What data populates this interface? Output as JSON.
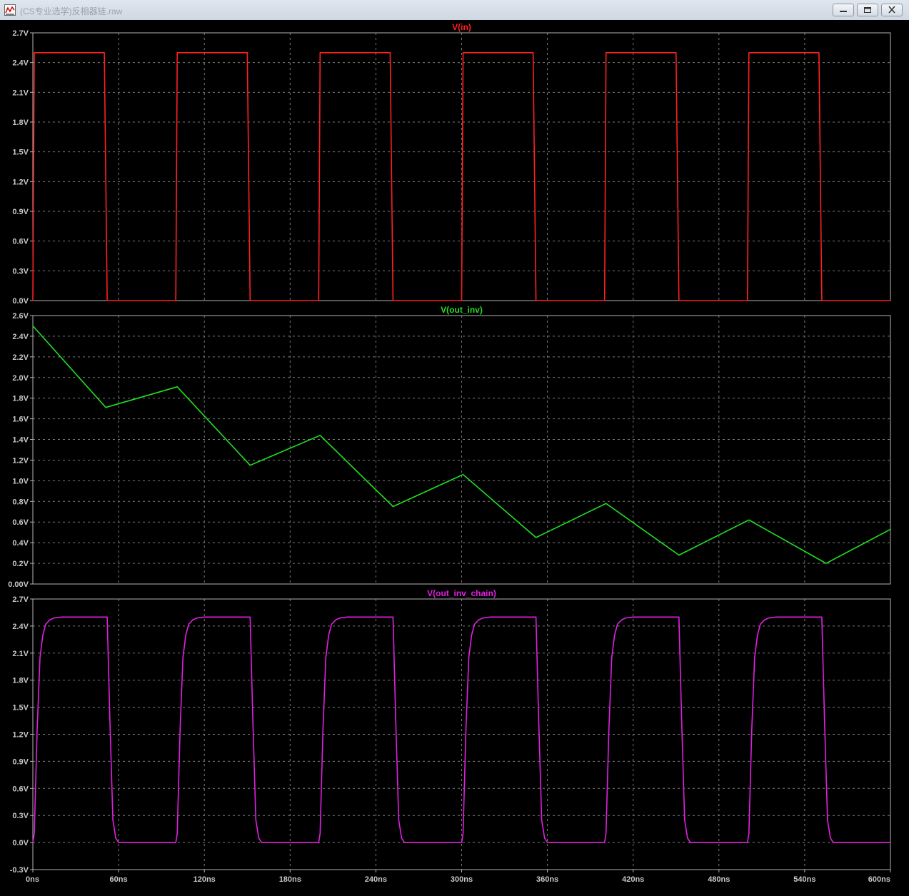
{
  "window": {
    "title": "(CS专业选学)反相器链.raw",
    "icon": "waveform-icon",
    "controls": [
      "minimize-icon",
      "maximize-icon",
      "close-icon"
    ]
  },
  "colors": {
    "background": "#000000",
    "grid": "#7a7a7a",
    "border": "#b4b4b4",
    "labels": "#c8c8c8"
  },
  "x_axis": {
    "unit": "ns",
    "range": [
      0,
      600
    ],
    "ticks": [
      0,
      60,
      120,
      180,
      240,
      300,
      360,
      420,
      480,
      540,
      600
    ],
    "tick_labels": [
      "0ns",
      "60ns",
      "120ns",
      "180ns",
      "240ns",
      "300ns",
      "360ns",
      "420ns",
      "480ns",
      "540ns",
      "600ns"
    ]
  },
  "chart_data": [
    {
      "type": "line",
      "title": "V(in)",
      "color": "#ff2020",
      "x_unit": "ns",
      "y_unit": "V",
      "ylim": [
        0,
        2.7
      ],
      "y_ticks": [
        0,
        0.3,
        0.6,
        0.9,
        1.2,
        1.5,
        1.8,
        2.1,
        2.4,
        2.7
      ],
      "y_tick_labels": [
        "0.0V",
        "0.3V",
        "0.6V",
        "0.9V",
        "1.2V",
        "1.5V",
        "1.8V",
        "2.1V",
        "2.4V",
        "2.7V"
      ],
      "grid": true,
      "x": [
        0,
        1,
        50,
        52,
        100,
        101,
        150,
        152,
        200,
        201,
        250,
        252,
        300,
        301,
        350,
        352,
        400,
        401,
        450,
        452,
        500,
        501,
        550,
        552,
        600
      ],
      "y": [
        0,
        2.5,
        2.5,
        0,
        0,
        2.5,
        2.5,
        0,
        0,
        2.5,
        2.5,
        0,
        0,
        2.5,
        2.5,
        0,
        0,
        2.5,
        2.5,
        0,
        0,
        2.5,
        2.5,
        0,
        0
      ]
    },
    {
      "type": "line",
      "title": "V(out_inv)",
      "color": "#22e022",
      "x_unit": "ns",
      "y_unit": "V",
      "ylim": [
        0,
        2.6
      ],
      "y_ticks": [
        0,
        0.2,
        0.4,
        0.6,
        0.8,
        1.0,
        1.2,
        1.4,
        1.6,
        1.8,
        2.0,
        2.2,
        2.4,
        2.6
      ],
      "y_tick_labels": [
        "0.00V",
        "0.2V",
        "0.4V",
        "0.6V",
        "0.8V",
        "1.0V",
        "1.2V",
        "1.4V",
        "1.6V",
        "1.8V",
        "2.0V",
        "2.2V",
        "2.4V",
        "2.6V"
      ],
      "grid": true,
      "x": [
        0,
        51,
        101,
        152,
        201,
        252,
        301,
        352,
        401,
        452,
        501,
        555,
        600
      ],
      "y": [
        2.5,
        1.71,
        1.91,
        1.15,
        1.44,
        0.75,
        1.06,
        0.45,
        0.78,
        0.28,
        0.62,
        0.2,
        0.53
      ]
    },
    {
      "type": "line",
      "title": "V(out_inv_chain)",
      "color": "#e020e0",
      "x_unit": "ns",
      "y_unit": "V",
      "ylim": [
        -0.3,
        2.7
      ],
      "y_ticks": [
        -0.3,
        0,
        0.3,
        0.6,
        0.9,
        1.2,
        1.5,
        1.8,
        2.1,
        2.4,
        2.7
      ],
      "y_tick_labels": [
        "-0.3V",
        "0.0V",
        "0.3V",
        "0.6V",
        "0.9V",
        "1.2V",
        "1.5V",
        "1.8V",
        "2.1V",
        "2.4V",
        "2.7V"
      ],
      "grid": true,
      "x": [
        0,
        1,
        3,
        5,
        7,
        9,
        12,
        15,
        20,
        52,
        54,
        56,
        58,
        60,
        100,
        101,
        103,
        105,
        107,
        109,
        112,
        115,
        120,
        152,
        154,
        156,
        158,
        160,
        200,
        201,
        203,
        205,
        207,
        209,
        212,
        215,
        220,
        252,
        254,
        256,
        258,
        260,
        300,
        301,
        303,
        305,
        307,
        309,
        312,
        315,
        320,
        352,
        354,
        356,
        358,
        360,
        400,
        401,
        403,
        405,
        407,
        409,
        412,
        415,
        420,
        452,
        454,
        456,
        458,
        460,
        500,
        501,
        503,
        505,
        507,
        509,
        512,
        515,
        520,
        552,
        554,
        556,
        558,
        560,
        600
      ],
      "y": [
        0,
        0.1,
        1.25,
        2.05,
        2.3,
        2.42,
        2.47,
        2.49,
        2.5,
        2.5,
        1.3,
        0.25,
        0.05,
        0,
        0,
        0.1,
        1.25,
        2.05,
        2.3,
        2.42,
        2.47,
        2.49,
        2.5,
        2.5,
        1.3,
        0.25,
        0.05,
        0,
        0,
        0.1,
        1.25,
        2.05,
        2.3,
        2.42,
        2.47,
        2.49,
        2.5,
        2.5,
        1.3,
        0.25,
        0.05,
        0,
        0,
        0.1,
        1.25,
        2.05,
        2.3,
        2.42,
        2.47,
        2.49,
        2.5,
        2.5,
        1.3,
        0.25,
        0.05,
        0,
        0,
        0.1,
        1.25,
        2.05,
        2.3,
        2.42,
        2.47,
        2.49,
        2.5,
        2.5,
        1.3,
        0.25,
        0.05,
        0,
        0,
        0.1,
        1.25,
        2.05,
        2.3,
        2.42,
        2.47,
        2.49,
        2.5,
        2.5,
        1.3,
        0.25,
        0.05,
        0,
        0
      ]
    }
  ]
}
